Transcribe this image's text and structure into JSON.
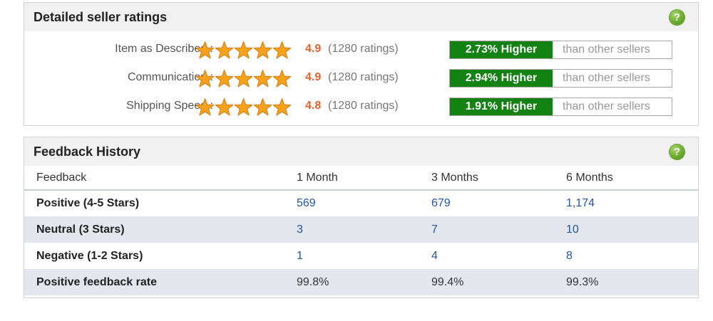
{
  "ratings_panel": {
    "title": "Detailed seller ratings",
    "help_icon": "question-help-icon",
    "help_glyph": "?",
    "rows": [
      {
        "label": "Item as Described :",
        "stars": 5,
        "score": "4.9",
        "count": "(1280 ratings)",
        "badge": "2.73% Higher",
        "compare": "than other sellers"
      },
      {
        "label": "Communication :",
        "stars": 5,
        "score": "4.9",
        "count": "(1280 ratings)",
        "badge": "2.94% Higher",
        "compare": "than other sellers"
      },
      {
        "label": "Shipping Speed :",
        "stars": 5,
        "score": "4.8",
        "count": "(1280 ratings)",
        "badge": "1.91% Higher",
        "compare": "than other sellers"
      }
    ]
  },
  "history_panel": {
    "title": "Feedback History",
    "help_icon": "question-help-icon",
    "help_glyph": "?",
    "columns": [
      "Feedback",
      "1 Month",
      "3 Months",
      "6 Months"
    ],
    "rows": [
      {
        "label": "Positive (4-5 Stars)",
        "values": [
          "569",
          "679",
          "1,174"
        ]
      },
      {
        "label": "Neutral (3 Stars)",
        "values": [
          "3",
          "7",
          "10"
        ]
      },
      {
        "label": "Negative (1-2 Stars)",
        "values": [
          "1",
          "4",
          "8"
        ]
      },
      {
        "label": "Positive feedback rate",
        "values": [
          "99.8%",
          "99.4%",
          "99.3%"
        ]
      }
    ]
  },
  "colors": {
    "star_fill": "#f7a21b",
    "star_stroke": "#d9780f",
    "score": "#e8612c",
    "badge_green": "#128212",
    "link_blue": "#2255aa",
    "alt_row": "#e5e7ee"
  }
}
